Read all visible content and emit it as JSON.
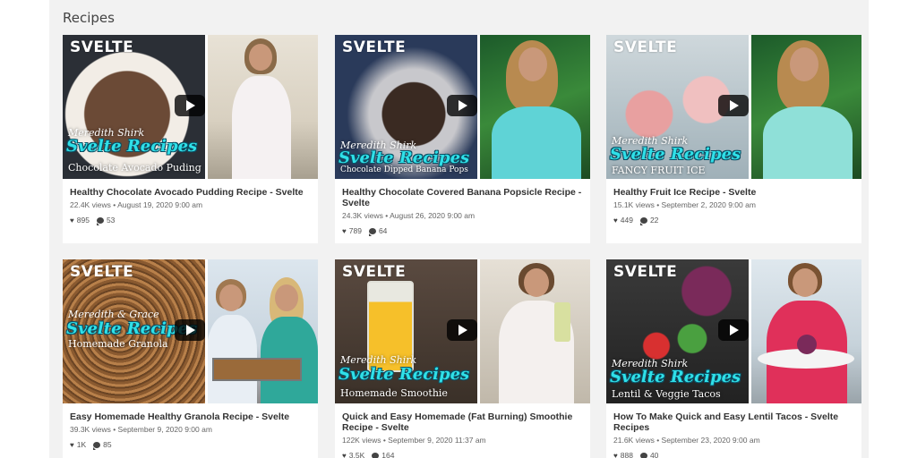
{
  "section": {
    "title": "Recipes"
  },
  "accent_color": "#3fd4e0",
  "logo_text": "SVELTE",
  "cards": [
    {
      "title": "Healthy Chocolate Avocado Pudding Recipe - Svelte",
      "views": "22.4K views",
      "date": "August 19, 2020 9:00 am",
      "likes": "895",
      "comments": "53",
      "caption_top": "Meredith Shirk",
      "caption_brand": "Svelte Recipes",
      "caption_bottom": "Chocolate Avocado Puding"
    },
    {
      "title": "Healthy Chocolate Covered Banana Popsicle Recipe - Svelte",
      "views": "24.3K views",
      "date": "August 26, 2020 9:00 am",
      "likes": "789",
      "comments": "64",
      "caption_top": "Meredith Shirk",
      "caption_brand": "Svelte Recipes",
      "caption_bottom": "Chocolate Dipped Banana Pops"
    },
    {
      "title": "Healthy Fruit Ice Recipe - Svelte",
      "views": "15.1K views",
      "date": "September 2, 2020 9:00 am",
      "likes": "449",
      "comments": "22",
      "caption_top": "Meredith Shirk",
      "caption_brand": "Svelte Recipes",
      "caption_bottom": "FANCY FRUIT ICE"
    },
    {
      "title": "Easy Homemade Healthy Granola Recipe - Svelte",
      "views": "39.3K views",
      "date": "September 9, 2020 9:00 am",
      "likes": "1K",
      "comments": "85",
      "caption_top": "Meredith & Grace",
      "caption_brand": "Svelte Recipes",
      "caption_bottom": "Homemade Granola"
    },
    {
      "title": "Quick and Easy Homemade (Fat Burning) Smoothie Recipe - Svelte",
      "views": "122K views",
      "date": "September 9, 2020 11:37 am",
      "likes": "3.5K",
      "comments": "164",
      "caption_top": "Meredith Shirk",
      "caption_brand": "Svelte Recipes",
      "caption_bottom": "Homemade Smoothie"
    },
    {
      "title": "How To Make Quick and Easy Lentil Tacos - Svelte Recipes",
      "views": "21.6K views",
      "date": "September 23, 2020 9:00 am",
      "likes": "888",
      "comments": "40",
      "caption_top": "Meredith Shirk",
      "caption_brand": "Svelte Recipes",
      "caption_bottom": "Lentil & Veggie Tacos"
    }
  ]
}
